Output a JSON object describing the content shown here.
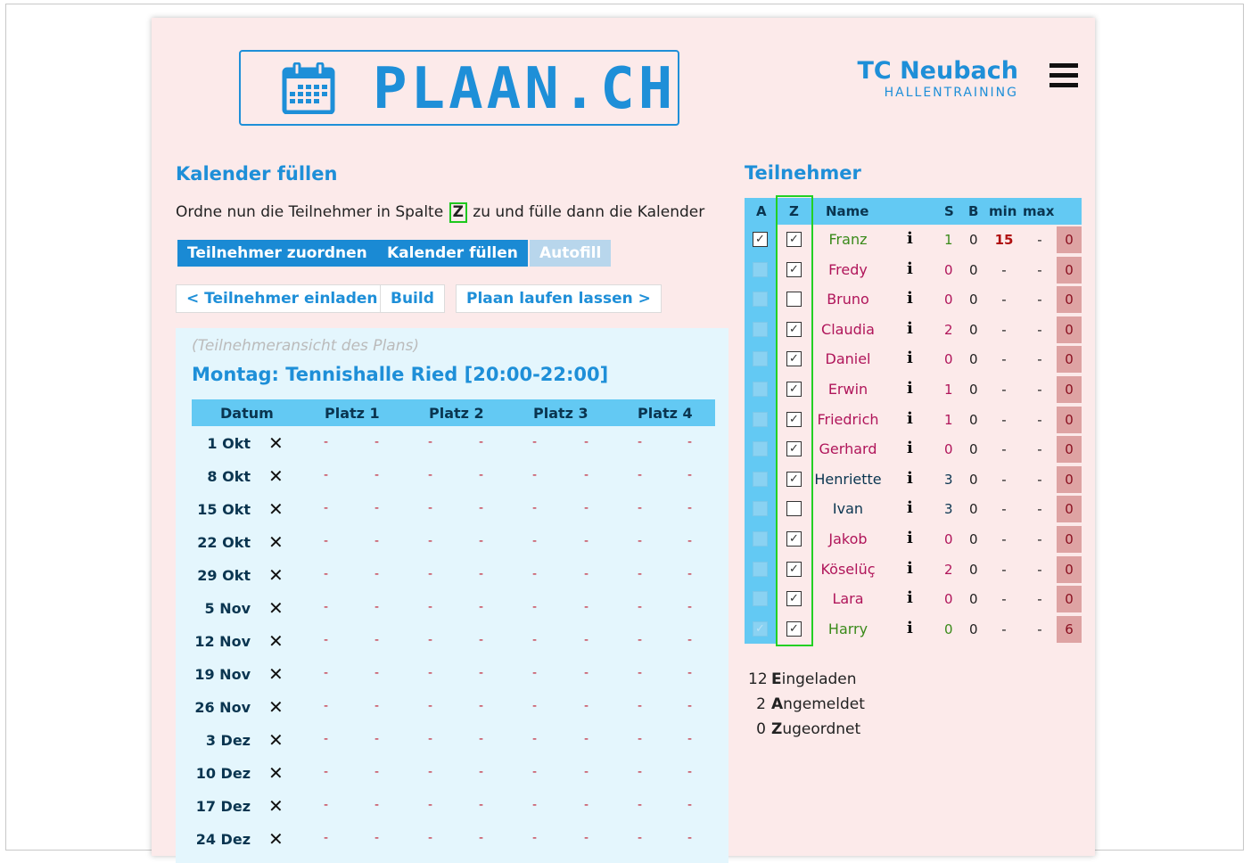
{
  "brand": {
    "logo_text": "PLAAN.CH"
  },
  "club": {
    "name": "TC Neubach",
    "subtitle": "HALLENTRAINING"
  },
  "left": {
    "heading": "Kalender füllen",
    "intro_before": "Ordne nun die Teilnehmer in Spalte ",
    "intro_col": "Z",
    "intro_after": " zu und fülle dann die Kalender",
    "buttons": {
      "assign": "Teilnehmer zuordnen",
      "fill": "Kalender füllen",
      "autofill": "Autofill",
      "invite": "< Teilnehmer einladen",
      "build": "Build",
      "run": "Plaan laufen lassen >"
    },
    "plan": {
      "note": "(Teilnehmeransicht des Plans)",
      "title": "Montag: Tennishalle Ried [20:00-22:00]",
      "headers": [
        "Datum",
        "Platz 1",
        "Platz 2",
        "Platz 3",
        "Platz 4"
      ],
      "dates": [
        "1 Okt",
        "8 Okt",
        "15 Okt",
        "22 Okt",
        "29 Okt",
        "5 Nov",
        "12 Nov",
        "19 Nov",
        "26 Nov",
        "3 Dez",
        "10 Dez",
        "17 Dez",
        "24 Dez"
      ],
      "cross": "✕",
      "dash": "-"
    }
  },
  "right": {
    "heading": "Teilnehmer",
    "headers": {
      "a": "A",
      "z": "Z",
      "name": "Name",
      "s": "S",
      "b": "B",
      "min": "min",
      "max": "max"
    },
    "info_glyph": "i",
    "rows": [
      {
        "name": "Franz",
        "a": true,
        "a_active": true,
        "z": true,
        "s": "1",
        "b": "0",
        "min": "15",
        "max": "-",
        "count": "0",
        "color": "#3a8a1a"
      },
      {
        "name": "Fredy",
        "a": false,
        "a_active": false,
        "z": true,
        "s": "0",
        "b": "0",
        "min": "-",
        "max": "-",
        "count": "0",
        "color": "#b0155a"
      },
      {
        "name": "Bruno",
        "a": false,
        "a_active": false,
        "z": false,
        "s": "0",
        "b": "0",
        "min": "-",
        "max": "-",
        "count": "0",
        "color": "#b0155a"
      },
      {
        "name": "Claudia",
        "a": false,
        "a_active": false,
        "z": true,
        "s": "2",
        "b": "0",
        "min": "-",
        "max": "-",
        "count": "0",
        "color": "#b0155a"
      },
      {
        "name": "Daniel",
        "a": false,
        "a_active": false,
        "z": true,
        "s": "0",
        "b": "0",
        "min": "-",
        "max": "-",
        "count": "0",
        "color": "#b0155a"
      },
      {
        "name": "Erwin",
        "a": false,
        "a_active": false,
        "z": true,
        "s": "1",
        "b": "0",
        "min": "-",
        "max": "-",
        "count": "0",
        "color": "#b0155a"
      },
      {
        "name": "Friedrich",
        "a": false,
        "a_active": false,
        "z": true,
        "s": "1",
        "b": "0",
        "min": "-",
        "max": "-",
        "count": "0",
        "color": "#b0155a"
      },
      {
        "name": "Gerhard",
        "a": false,
        "a_active": false,
        "z": true,
        "s": "0",
        "b": "0",
        "min": "-",
        "max": "-",
        "count": "0",
        "color": "#b0155a"
      },
      {
        "name": "Henriette",
        "a": false,
        "a_active": false,
        "z": true,
        "s": "3",
        "b": "0",
        "min": "-",
        "max": "-",
        "count": "0",
        "color": "#0a3550"
      },
      {
        "name": "Ivan",
        "a": false,
        "a_active": false,
        "z": false,
        "s": "3",
        "b": "0",
        "min": "-",
        "max": "-",
        "count": "0",
        "color": "#0a3550"
      },
      {
        "name": "Jakob",
        "a": false,
        "a_active": false,
        "z": true,
        "s": "0",
        "b": "0",
        "min": "-",
        "max": "-",
        "count": "0",
        "color": "#b0155a"
      },
      {
        "name": "Köselüç",
        "a": false,
        "a_active": false,
        "z": true,
        "s": "2",
        "b": "0",
        "min": "-",
        "max": "-",
        "count": "0",
        "color": "#b0155a"
      },
      {
        "name": "Lara",
        "a": false,
        "a_active": false,
        "z": true,
        "s": "0",
        "b": "0",
        "min": "-",
        "max": "-",
        "count": "0",
        "color": "#b0155a"
      },
      {
        "name": "Harry",
        "a": true,
        "a_active": false,
        "z": true,
        "s": "0",
        "b": "0",
        "min": "-",
        "max": "-",
        "count": "6",
        "color": "#3a8a1a"
      }
    ],
    "stats": [
      {
        "num": "12",
        "initial": "E",
        "rest": "ingeladen"
      },
      {
        "num": "2",
        "initial": "A",
        "rest": "ngemeldet"
      },
      {
        "num": "0",
        "initial": "Z",
        "rest": "ugeordnet"
      }
    ]
  },
  "colors": {
    "accent": "#1e8fd8",
    "header_bg": "#63c9f3",
    "page_bg": "#fceaea",
    "assign_frame": "#23d023"
  }
}
